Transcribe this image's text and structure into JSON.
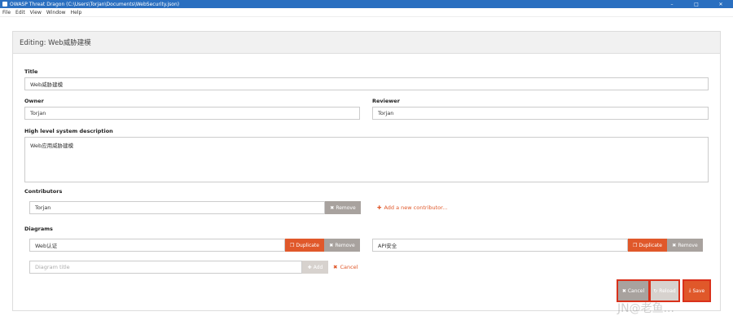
{
  "window": {
    "title": "OWASP Threat Dragon (C:\\Users\\Torjan\\Documents\\WebSecurity.json)",
    "minimize": "–",
    "maximize": "□",
    "close": "✕"
  },
  "menu": [
    "File",
    "Edit",
    "View",
    "Window",
    "Help"
  ],
  "panel": {
    "heading": "Editing: Web威胁建模"
  },
  "fields": {
    "title_label": "Title",
    "title_value": "Web威胁建模",
    "owner_label": "Owner",
    "owner_value": "Torjan",
    "reviewer_label": "Reviewer",
    "reviewer_value": "Torjan",
    "desc_label": "High level system description",
    "desc_value": "Web应用威胁建模"
  },
  "contributors": {
    "label": "Contributors",
    "items": [
      {
        "name": "Torjan",
        "remove_label": "Remove"
      }
    ],
    "add_label": "Add a new contributor..."
  },
  "diagrams": {
    "label": "Diagrams",
    "items": [
      {
        "name": "Web认证",
        "duplicate_label": "Duplicate",
        "remove_label": "Remove"
      },
      {
        "name": "API安全",
        "duplicate_label": "Duplicate",
        "remove_label": "Remove"
      }
    ],
    "new_placeholder": "Diagram title",
    "add_label": "Add",
    "cancel_label": "Cancel"
  },
  "footer": {
    "cancel_label": "Cancel",
    "reload_label": "Reload",
    "save_label": "Save"
  },
  "watermark": "JN@老鱼..."
}
